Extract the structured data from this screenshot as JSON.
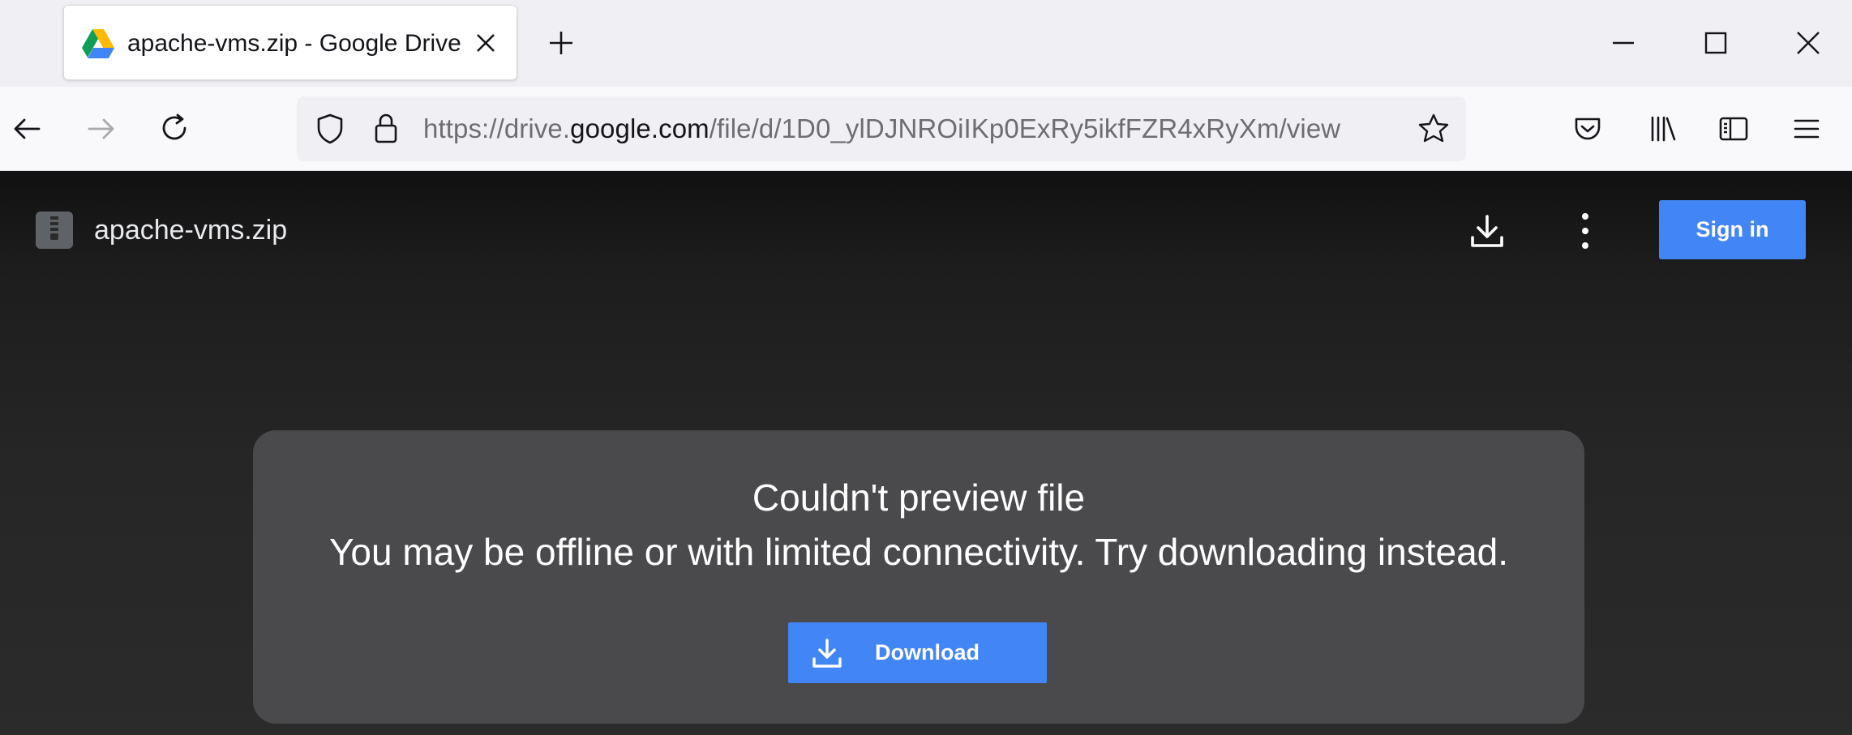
{
  "browser": {
    "tab": {
      "title": "apache-vms.zip - Google Drive",
      "favicon": "google-drive-icon",
      "close_icon": "close-icon"
    },
    "new_tab_icon": "plus-icon",
    "window_controls": [
      "minimize-icon",
      "maximize-icon",
      "close-icon"
    ],
    "nav": {
      "back_icon": "arrow-left-icon",
      "forward_icon": "arrow-right-icon",
      "reload_icon": "reload-icon"
    },
    "url": {
      "prefix": "https://drive.",
      "host": "google.com",
      "path": "/file/d/1D0_ylDJNROiIKp0ExRy5ikfFZR4xRyXm/view"
    },
    "toolbar_icons": [
      "shield-icon",
      "lock-icon",
      "star-icon",
      "pocket-icon",
      "library-icon",
      "sidebar-icon",
      "menu-icon"
    ]
  },
  "viewer": {
    "file_name": "apache-vms.zip",
    "signin_label": "Sign in",
    "card": {
      "title": "Couldn't preview file",
      "message": "You may be offline or with limited connectivity. Try downloading instead.",
      "download_label": "Download"
    }
  },
  "colors": {
    "accent": "#4285f4",
    "card_bg": "#4a494c",
    "viewer_bg": "#2b2b2b",
    "tabstrip_bg": "#f0f0f4"
  }
}
